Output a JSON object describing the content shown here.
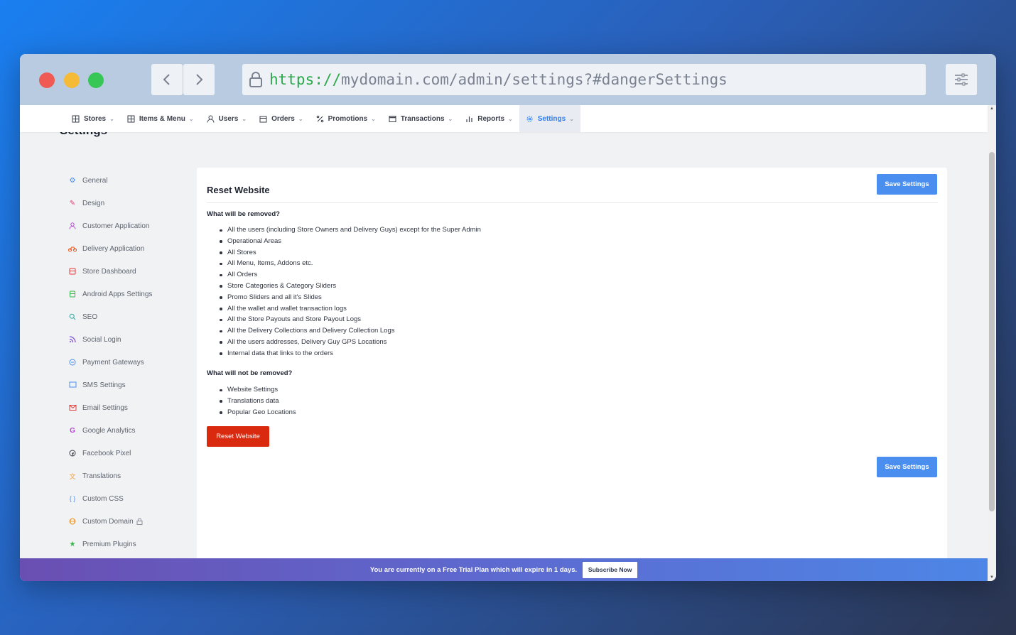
{
  "browser": {
    "url_scheme": "https://",
    "url_rest": "mydomain.com/admin/settings?#dangerSettings"
  },
  "topnav": [
    {
      "label": "Stores",
      "icon": "grid-icon"
    },
    {
      "label": "Items & Menu",
      "icon": "grid-icon"
    },
    {
      "label": "Users",
      "icon": "user-icon"
    },
    {
      "label": "Orders",
      "icon": "orders-icon"
    },
    {
      "label": "Promotions",
      "icon": "percent-icon"
    },
    {
      "label": "Transactions",
      "icon": "card-icon"
    },
    {
      "label": "Reports",
      "icon": "bar-chart-icon"
    },
    {
      "label": "Settings",
      "icon": "gear-icon",
      "active": true
    }
  ],
  "page": {
    "heading": "Settings"
  },
  "sidebar": [
    {
      "label": "General",
      "icon": "gear-icon",
      "color": "#4a8ef0"
    },
    {
      "label": "Design",
      "icon": "brush-icon",
      "color": "#e0457b"
    },
    {
      "label": "Customer Application",
      "icon": "user-icon",
      "color": "#b44bd8"
    },
    {
      "label": "Delivery Application",
      "icon": "bike-icon",
      "color": "#e8541e"
    },
    {
      "label": "Store Dashboard",
      "icon": "store-icon",
      "color": "#e33a3a"
    },
    {
      "label": "Android Apps Settings",
      "icon": "android-icon",
      "color": "#37b34a"
    },
    {
      "label": "SEO",
      "icon": "search-icon",
      "color": "#2aa6a0"
    },
    {
      "label": "Social Login",
      "icon": "rss-icon",
      "color": "#7b4fd6"
    },
    {
      "label": "Payment Gateways",
      "icon": "payment-icon",
      "color": "#4a8ef0"
    },
    {
      "label": "SMS Settings",
      "icon": "message-icon",
      "color": "#4a8ef0"
    },
    {
      "label": "Email Settings",
      "icon": "mail-icon",
      "color": "#e33a3a"
    },
    {
      "label": "Google Analytics",
      "icon": "google-icon",
      "color": "#b44bd8"
    },
    {
      "label": "Facebook Pixel",
      "icon": "facebook-icon",
      "color": "#3a3f4a"
    },
    {
      "label": "Translations",
      "icon": "translate-icon",
      "color": "#f0a13a"
    },
    {
      "label": "Custom CSS",
      "icon": "braces-icon",
      "color": "#4a8ef0"
    },
    {
      "label": "Custom Domain",
      "icon": "globe-icon",
      "color": "#f0a13a",
      "locked": true
    },
    {
      "label": "Premium Plugins",
      "icon": "star-icon",
      "color": "#37b34a"
    }
  ],
  "card": {
    "title": "Reset Website",
    "save_label": "Save Settings",
    "removed_heading": "What will be removed?",
    "removed_items": [
      "All the users (including Store Owners and Delivery Guys) except for the Super Admin",
      "Operational Areas",
      "All Stores",
      "All Menu, Items, Addons etc.",
      "All Orders",
      "Store Categories & Category Sliders",
      "Promo Sliders and all it's Slides",
      "All the wallet and wallet transaction logs",
      "All the Store Payouts and Store Payout Logs",
      "All the Delivery Collections and Delivery Collection Logs",
      "All the users addresses, Delivery Guy GPS Locations",
      "Internal data that links to the orders"
    ],
    "kept_heading": "What will not be removed?",
    "kept_items": [
      "Website Settings",
      "Translations data",
      "Popular Geo Locations"
    ],
    "reset_label": "Reset Website"
  },
  "trial": {
    "message": "You are currently on a Free Trial Plan which will expire in 1 days.",
    "subscribe_label": "Subscribe Now"
  }
}
